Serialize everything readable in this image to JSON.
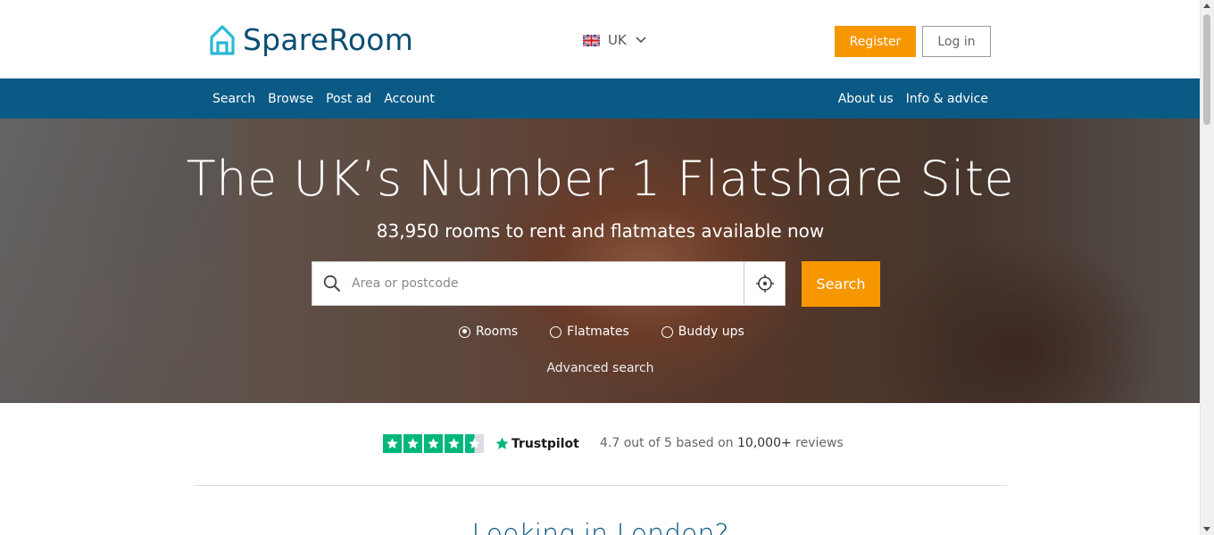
{
  "header": {
    "logo_text": "SpareRoom",
    "region": "UK",
    "register_label": "Register",
    "login_label": "Log in"
  },
  "nav": {
    "left": [
      "Search",
      "Browse",
      "Post ad",
      "Account"
    ],
    "right": [
      "About us",
      "Info & advice"
    ]
  },
  "hero": {
    "title": "The UK’s Number 1 Flatshare Site",
    "subtitle": "83,950 rooms to rent and flatmates available now",
    "search_placeholder": "Area or postcode",
    "search_button": "Search",
    "options": [
      "Rooms",
      "Flatmates",
      "Buddy ups"
    ],
    "selected_option": "Rooms",
    "advanced_link": "Advanced search"
  },
  "trust": {
    "brand": "Trustpilot",
    "rating_prefix": "4.7 out of 5 based on",
    "review_count": "10,000+",
    "rating_suffix": "reviews",
    "stars": 4.5
  },
  "section": {
    "heading": "Looking in London?"
  },
  "colors": {
    "brand_blue": "#0a5a85",
    "accent_orange": "#f79700",
    "trustpilot_green": "#00b67a"
  }
}
